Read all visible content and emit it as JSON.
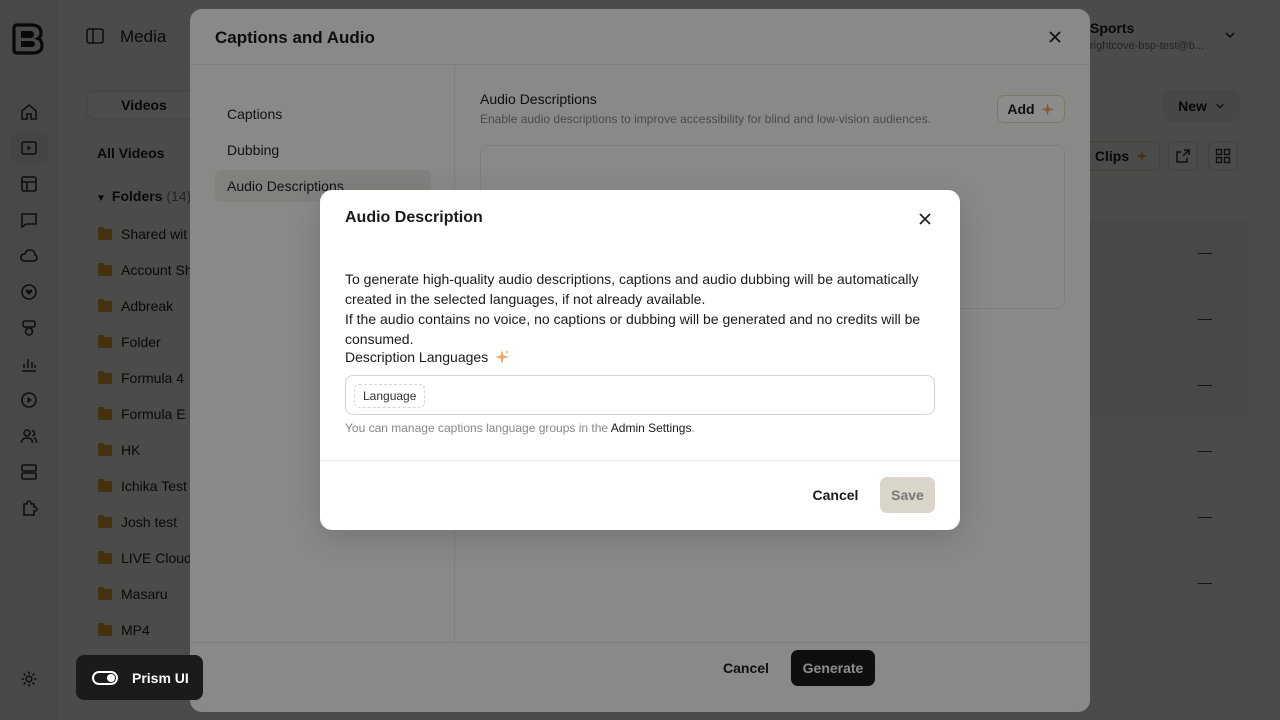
{
  "app": {
    "section_title": "Media",
    "account": {
      "name": "Sports",
      "email": "rightcove-bsp-test@b..."
    },
    "tabs": {
      "active": "Videos"
    },
    "all_videos": "All Videos",
    "folders": {
      "label": "Folders",
      "count": "(14)",
      "items": [
        {
          "label": "Shared wit"
        },
        {
          "label": "Account Sh"
        },
        {
          "label": "Adbreak"
        },
        {
          "label": "Folder"
        },
        {
          "label": "Formula 4"
        },
        {
          "label": "Formula E"
        },
        {
          "label": "HK"
        },
        {
          "label": "Ichika Test"
        },
        {
          "label": "Josh test"
        },
        {
          "label": "LIVE Cloud"
        },
        {
          "label": "Masaru"
        },
        {
          "label": "MP4"
        }
      ]
    },
    "new_button": "New",
    "clips_button": "Clips",
    "prism_ui": "Prism UI"
  },
  "captions_modal": {
    "title": "Captions and Audio",
    "nav": [
      {
        "label": "Captions"
      },
      {
        "label": "Dubbing"
      },
      {
        "label": "Audio Descriptions"
      }
    ],
    "section_title": "Audio Descriptions",
    "section_subtitle": "Enable audio descriptions to improve accessibility for blind and low-vision audiences.",
    "add_button": "Add",
    "cancel_button": "Cancel",
    "generate_button": "Generate"
  },
  "audio_dialog": {
    "title": "Audio Description",
    "paragraph1": "To generate high-quality audio descriptions, captions and audio dubbing will be automatically created in the selected languages, if not already available.",
    "paragraph2": "If the audio contains no voice, no captions or dubbing will be generated and no credits will be consumed.",
    "languages_label": "Description Languages",
    "language_chip": "Language",
    "hint_prefix": "You can manage captions language groups in the ",
    "hint_link": "Admin Settings",
    "hint_suffix": ".",
    "cancel_button": "Cancel",
    "save_button": "Save"
  },
  "colors": {
    "accent_sparkle": "#f0a868",
    "primary_button": "#1b1b1b",
    "disabled_button": "#d9d6c9",
    "folder": "#e2a630"
  },
  "icons": {
    "rail": [
      "home-icon",
      "video-icon",
      "playlist-icon",
      "chat-icon",
      "cloud-icon",
      "heart-icon",
      "layers-icon",
      "analytics-icon",
      "play-circle-icon",
      "users-icon",
      "server-icon",
      "plugin-icon",
      "settings-icon"
    ]
  }
}
